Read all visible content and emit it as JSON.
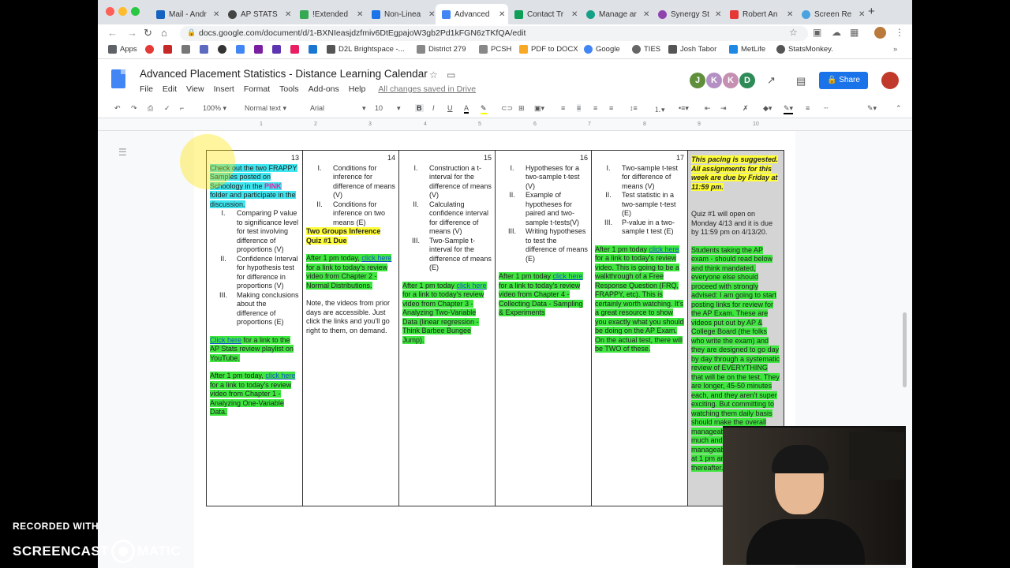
{
  "browser": {
    "tabs": [
      {
        "label": "Mail - Andr",
        "color": "#1565c0"
      },
      {
        "label": "AP STATS",
        "color": "#444444"
      },
      {
        "label": "!Extended",
        "color": "#34a853"
      },
      {
        "label": "Non-Linea",
        "color": "#1a73e8"
      },
      {
        "label": "Advanced",
        "color": "#4285f4"
      },
      {
        "label": "Contact Tr",
        "color": "#0f9d58"
      },
      {
        "label": "Manage ar",
        "color": "#16a085"
      },
      {
        "label": "Synergy St",
        "color": "#8e44ad"
      },
      {
        "label": "Robert An",
        "color": "#e53935"
      },
      {
        "label": "Screen Re",
        "color": "#4aa3df"
      }
    ],
    "url": "docs.google.com/document/d/1-BXNIeasjdzfmiv6DtEgpajoW3gb2Pd1kFGN6zTKfQA/edit",
    "bookmarks": [
      "Apps",
      "D2L Brightspace -...",
      "District 279",
      "PCSH",
      "PDF to DOCX",
      "Google",
      "TIES",
      "Josh Tabor",
      "MetLife",
      "StatsMonkey."
    ]
  },
  "doc": {
    "title": "Advanced Placement Statistics - Distance Learning Calendar",
    "menu": [
      "File",
      "Edit",
      "View",
      "Insert",
      "Format",
      "Tools",
      "Add-ons",
      "Help"
    ],
    "saved_status": "All changes saved in Drive",
    "collaborators": [
      {
        "initial": "J",
        "color": "#5f8f3a"
      },
      {
        "initial": "K",
        "color": "#b48fc4"
      },
      {
        "initial": "K",
        "color": "#c48fb0"
      },
      {
        "initial": "D",
        "color": "#2e8b57"
      }
    ],
    "share_label": "Share",
    "toolbar": {
      "zoom": "100%",
      "style": "Normal text",
      "font": "Arial",
      "size": "10"
    },
    "ruler": [
      "1",
      "2",
      "3",
      "4",
      "5",
      "6",
      "7",
      "8",
      "9",
      "10"
    ]
  },
  "calendar": {
    "mon": {
      "day": "13",
      "intro": "Check out the two FRAPPY Samples posted on Schoology in the ",
      "pink": "PINK",
      "intro_end": " folder and participate in the discussion.",
      "items": [
        {
          "num": "I.",
          "text": "Comparing P value to significance level for test involving difference of proportions (V)"
        },
        {
          "num": "II.",
          "text": "Confidence Interval for hypothesis test for difference in proportions (V)"
        },
        {
          "num": "III.",
          "text": "Making conclusions about the difference of proportions (E)"
        }
      ],
      "playlist_link": "Click here",
      "playlist_text": " for a link to the AP Stats review playlist on YouTube.",
      "review_pre": "After 1 pm today, ",
      "review_link": "click here",
      "review_post": " for a link to today's review video from Chapter 1 - Analyzing One-Variable Data."
    },
    "tue": {
      "day": "14",
      "items": [
        {
          "num": "I.",
          "text": "Conditions for inference for difference of means (V)"
        },
        {
          "num": "II.",
          "text": "Conditions for inference on two means (E)"
        }
      ],
      "quiz": "Two Groups Inference Quiz #1 Due",
      "review_pre": "After 1 pm today, ",
      "review_link": "click here",
      "review_post": " for a link to today's review video from Chapter 2 - Normal Distributions.",
      "note": "Note, the videos from prior days are accessible. Just click the links and you'll go right to them, on demand."
    },
    "wed": {
      "day": "15",
      "items": [
        {
          "num": "I.",
          "text": "Construction a t-interval for the difference of means (V)"
        },
        {
          "num": "II.",
          "text": "Calculating confidence interval for difference of means (V)"
        },
        {
          "num": "III.",
          "text": "Two-Sample t-interval for the difference of means (E)"
        }
      ],
      "review_pre": "After 1 pm today ",
      "review_link": "click here",
      "review_post": " for a link to today's review video from Chapter 3 - Analyzing Two-Variable Data (linear regression - Think Barbee Bungee Jump)."
    },
    "thu": {
      "day": "16",
      "items": [
        {
          "num": "I.",
          "text": "Hypotheses for a two-sample t-test (V)"
        },
        {
          "num": "II.",
          "text": "Example of hypotheses for paired and two-sample t-tests(V)"
        },
        {
          "num": "III.",
          "text": "Writing hypotheses to test the difference of means (E)"
        }
      ],
      "review_pre": "After 1 pm today ",
      "review_link": "click here",
      "review_post": " for a link to today's review video from Chapter 4 - Collecting Data - Sampling & Experiments"
    },
    "fri": {
      "day": "17",
      "items": [
        {
          "num": "I.",
          "text": "Two-sample t-test for difference of means (V)"
        },
        {
          "num": "II.",
          "text": "Test statistic in a two-sample t-test (E)"
        },
        {
          "num": "III.",
          "text": "P-value in a two-sample t test (E)"
        }
      ],
      "review_pre": "After 1 pm today ",
      "review_link": "click here",
      "review_post": " for a link to today's review video. This is going to be a walkthrough of a Free Response Question (FRQ, FRAPPY, etc). This is certainly worth watching. It's a great resource to show you exactly what you should be doing on the AP Exam. On the actual test, there will be TWO of these."
    },
    "notes": {
      "pacing": "This pacing is suggested. All assignments for this week are due by Friday at 11:59 pm.",
      "quiz": "Quiz #1 will open on Monday 4/13 and it is due by 11:59 pm on 4/13/20.",
      "ap_exam": "Students taking the AP exam - should read below and think mandated, everyone else should proceed with strongly advised: I am going to start posting links for review for the AP Exam. These are videos put out by AP & College Board (the folks who write the exam) and they are designed to go day by day through a systematic review of EVERYTHING that will be on the test. They are longer, 45-50 minutes each, and they aren't super exciting. But committing to watching them daily basis should make the overall manageable. Take time much and doing it is manageable; they are LIVE at 1 pm and available thereafter."
    }
  },
  "overlay": {
    "watermark_line1": "RECORDED WITH",
    "watermark_line2a": "SCREENCAST",
    "watermark_line2b": "MATIC"
  }
}
